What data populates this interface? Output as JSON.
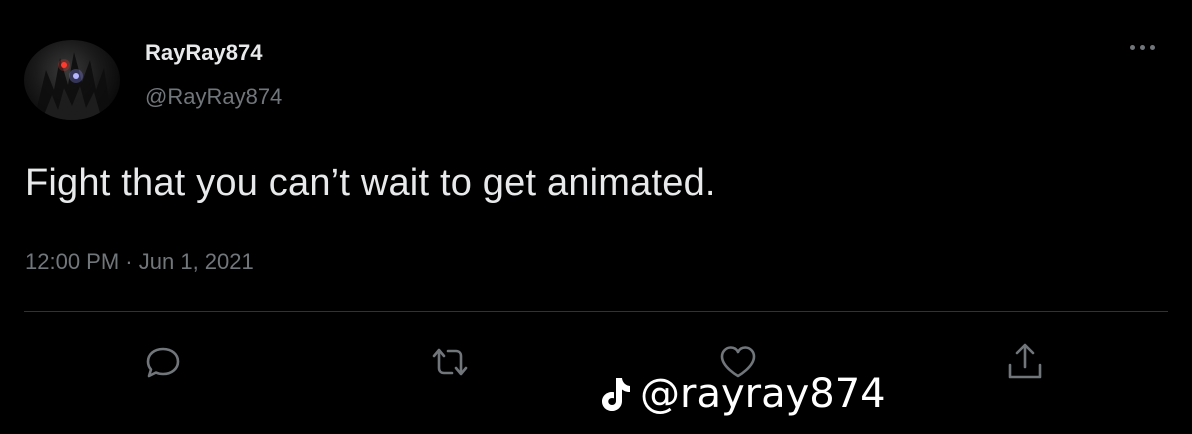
{
  "tweet": {
    "author": {
      "display_name": "RayRay874",
      "handle": "@RayRay874",
      "avatar_icon": "profile-avatar"
    },
    "text": "Fight that you can’t wait to get animated.",
    "time": "12:00 PM",
    "separator": "·",
    "date": "Jun 1, 2021",
    "more_icon": "more-options-icon"
  },
  "actions": [
    {
      "name": "reply",
      "icon": "reply-icon"
    },
    {
      "name": "retweet",
      "icon": "retweet-icon"
    },
    {
      "name": "like",
      "icon": "heart-icon"
    },
    {
      "name": "share",
      "icon": "share-icon"
    }
  ],
  "watermark": {
    "icon": "tiktok-icon",
    "text": "@rayray874"
  },
  "colors": {
    "background": "#000000",
    "primary_text": "#e7e9ea",
    "secondary_text": "#71767b",
    "divider": "#2f3336"
  }
}
